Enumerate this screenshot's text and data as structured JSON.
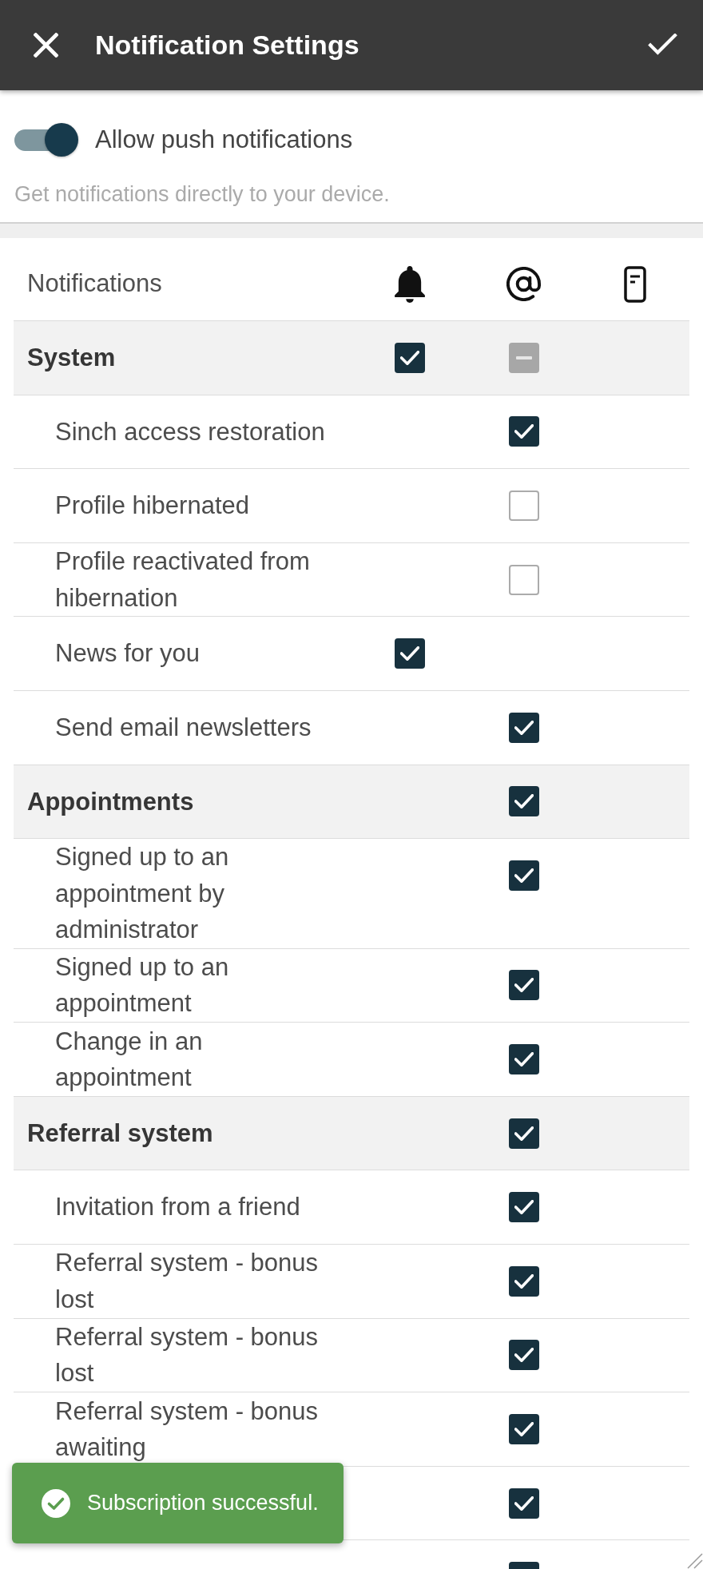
{
  "header": {
    "title": "Notification Settings"
  },
  "push_notifications": {
    "label": "Allow push notifications",
    "on": true,
    "description": "Get notifications directly to your device."
  },
  "table": {
    "heading": "Notifications",
    "groups": [
      {
        "label": "System",
        "push": {
          "checked": true
        },
        "email": {
          "mixed": true
        },
        "children": [
          {
            "label": "Sinch access restoration",
            "email": {
              "checked": true
            }
          },
          {
            "label": "Profile hibernated",
            "email": {
              "checked": false
            }
          },
          {
            "label": "Profile reactivated from hibernation",
            "email": {
              "checked": false
            }
          },
          {
            "label": "News for you",
            "push": {
              "checked": true
            }
          },
          {
            "label": "Send email newsletters",
            "email": {
              "checked": true
            }
          }
        ]
      },
      {
        "label": "Appointments",
        "email": {
          "checked": true
        },
        "children": [
          {
            "label": "Signed up to an appointment by administrator",
            "email": {
              "checked": true
            }
          },
          {
            "label": "Signed up to an appointment",
            "email": {
              "checked": true
            }
          },
          {
            "label": "Change in an appointment",
            "email": {
              "checked": true
            }
          }
        ]
      },
      {
        "label": "Referral system",
        "email": {
          "checked": true
        },
        "children": [
          {
            "label": "Invitation from a friend",
            "email": {
              "checked": true
            }
          },
          {
            "label": "Referral system - bonus lost",
            "email": {
              "checked": true
            }
          },
          {
            "label": "Referral system - bonus lost",
            "email": {
              "checked": true
            }
          },
          {
            "label": "Referral system - bonus awaiting",
            "email": {
              "checked": true
            }
          },
          {
            "email": {
              "checked": true
            }
          },
          {
            "email": {
              "checked": true
            }
          }
        ]
      }
    ]
  },
  "toast": {
    "message": "Subscription successful."
  }
}
